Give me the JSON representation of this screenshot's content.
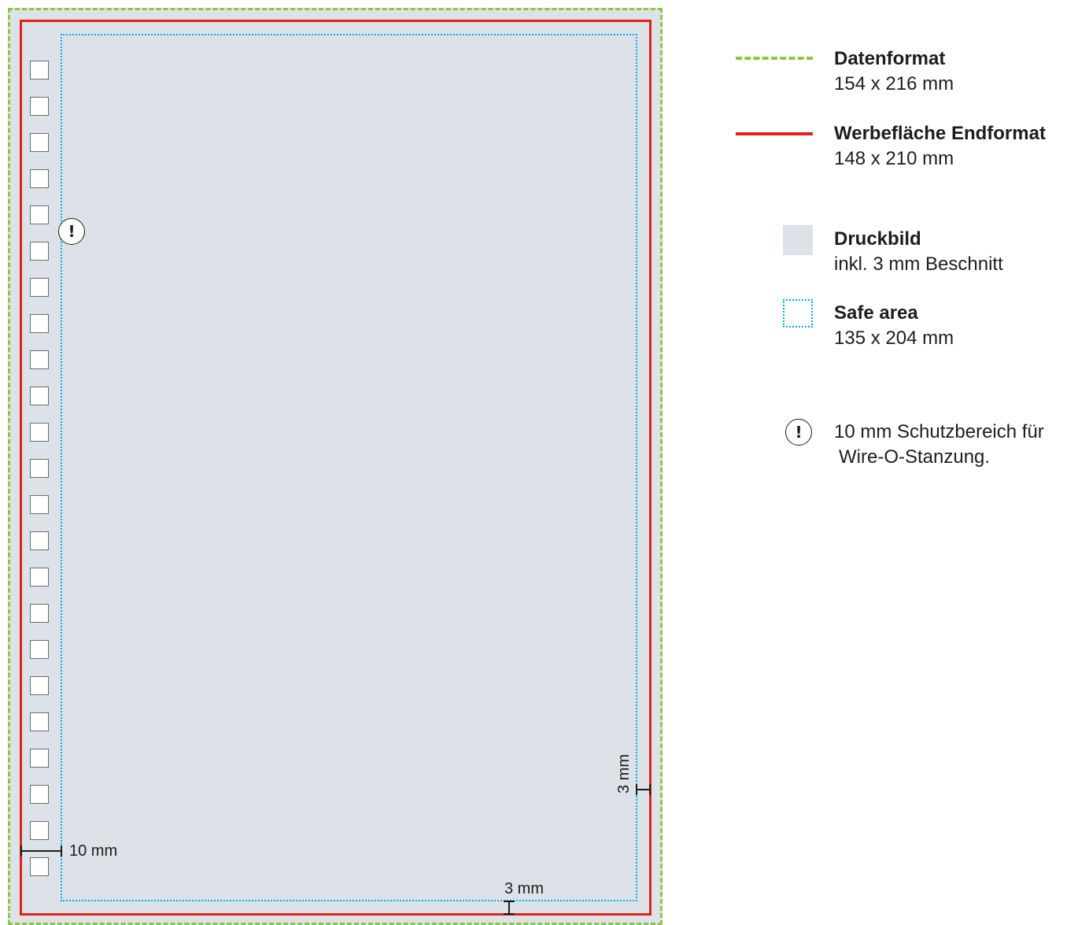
{
  "colors": {
    "data_format_line": "#8dc63f",
    "trim_line": "#e2231a",
    "print_image_fill": "#dde2e8",
    "safe_area_line": "#00aeef",
    "punch_hole_fill": "#ffffff",
    "text": "#1d1d1b"
  },
  "artwork": {
    "punch_hole_count": 23,
    "warning_icon": "exclamation-circle-icon",
    "warning_glyph": "!",
    "dimensions": {
      "left_margin": "10 mm",
      "right_margin": "3 mm",
      "bottom_margin": "3 mm"
    }
  },
  "legend": {
    "data_format": {
      "title": "Datenformat",
      "size": "154 x 216 mm"
    },
    "trim": {
      "title": "Werbefläche Endformat",
      "size": "148 x 210 mm"
    },
    "print_image": {
      "title": "Druckbild",
      "note": "inkl. 3 mm Beschnitt"
    },
    "safe_area": {
      "title": "Safe area",
      "size": "135 x 204 mm"
    },
    "warning": {
      "icon": "exclamation-circle-icon",
      "glyph": "!",
      "line1": "10 mm Schutzbereich für",
      "line2": "Wire-O-Stanzung."
    }
  }
}
